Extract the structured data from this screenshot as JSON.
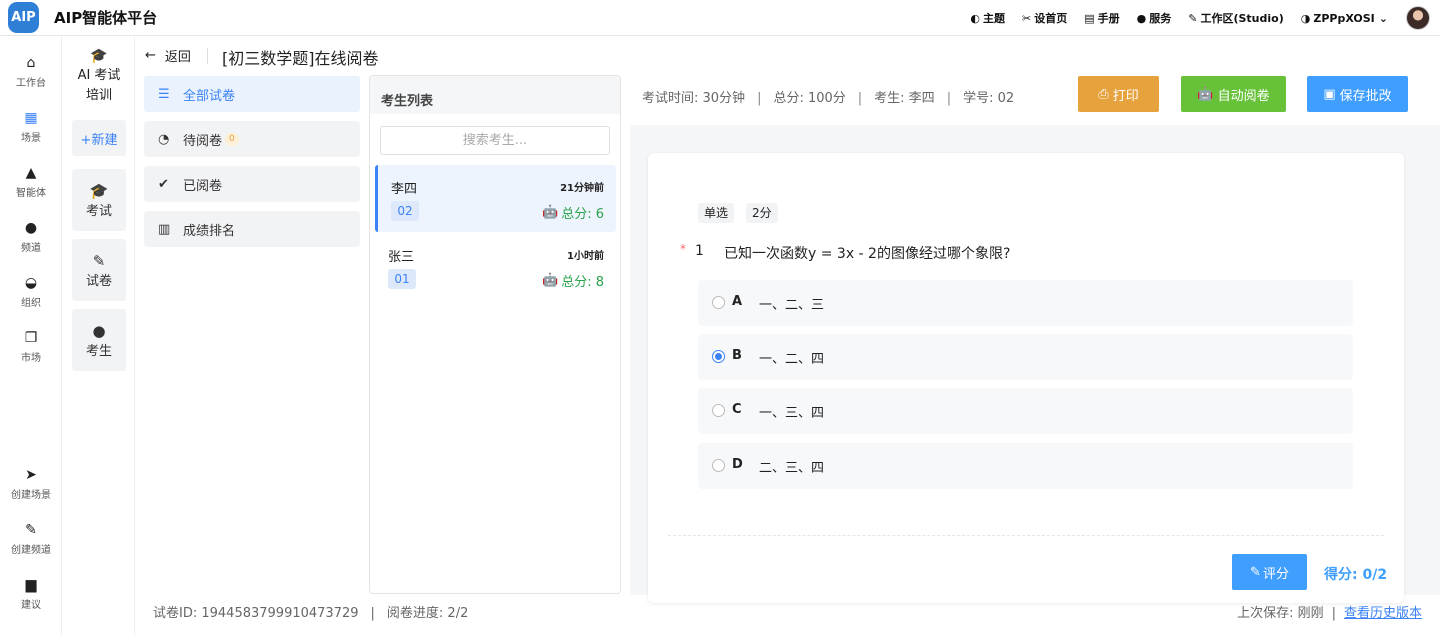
{
  "app": {
    "logo_text": "AIP",
    "title": "AIP智能体平台"
  },
  "topnav": {
    "items": [
      {
        "icon": "moon-icon",
        "glyph": "◐",
        "label": "主题"
      },
      {
        "icon": "tools-icon",
        "glyph": "✂",
        "label": "设首页"
      },
      {
        "icon": "book-icon",
        "glyph": "▤",
        "label": "手册"
      },
      {
        "icon": "users-icon",
        "glyph": "👥",
        "label": "服务"
      },
      {
        "icon": "pen-icon",
        "glyph": "✎",
        "label": "工作区(Studio)"
      },
      {
        "icon": "shield-icon",
        "glyph": "◑",
        "label": "ZPPpXOSI"
      }
    ]
  },
  "rail": {
    "items": [
      {
        "label": "工作台"
      },
      {
        "label": "场景"
      },
      {
        "label": "智能体"
      },
      {
        "label": "频道"
      },
      {
        "label": "组织"
      },
      {
        "label": "市场"
      },
      {
        "label": "创建场景"
      },
      {
        "label": "创建频道"
      },
      {
        "label": "建议"
      }
    ]
  },
  "section": {
    "title_line1": "AI 考试",
    "title_line2": "培训",
    "new_label": "+新建",
    "items": [
      {
        "label": "考试"
      },
      {
        "label": "试卷"
      },
      {
        "label": "考生"
      }
    ]
  },
  "header": {
    "back_label": "返回",
    "title": "[初三数学题]在线阅卷"
  },
  "filters": [
    {
      "label": "全部试卷"
    },
    {
      "label": "待阅卷",
      "badge": "0"
    },
    {
      "label": "已阅卷"
    },
    {
      "label": "成绩排名"
    }
  ],
  "students": {
    "header": "考生列表",
    "search_placeholder": "搜索考生...",
    "list": [
      {
        "name": "李四",
        "time": "21分钟前",
        "id": "02",
        "score": "总分: 6"
      },
      {
        "name": "张三",
        "time": "1小时前",
        "id": "01",
        "score": "总分: 8"
      }
    ]
  },
  "exam_info": {
    "time": "考试时间: 30分钟",
    "total": "总分: 100分",
    "student": "考生: 李四",
    "student_no": "学号: 02"
  },
  "actions": {
    "print": "打印",
    "auto_grade": "自动阅卷",
    "save": "保存批改"
  },
  "question": {
    "type_tag": "单选",
    "points_tag": "2分",
    "required_mark": "*",
    "number": "1",
    "text": "已知一次函数y = 3x - 2的图像经过哪个象限?",
    "selected": "B",
    "options": [
      {
        "letter": "A",
        "text": "一、二、三"
      },
      {
        "letter": "B",
        "text": "一、二、四"
      },
      {
        "letter": "C",
        "text": "一、三、四"
      },
      {
        "letter": "D",
        "text": "二、三、四"
      }
    ],
    "grade_button": "评分",
    "score": "得分: 0/2"
  },
  "footer": {
    "paper_id": "试卷ID: 1944583799910473729",
    "progress": "阅卷进度: 2/2",
    "last_saved": "上次保存: 刚刚",
    "history_link": "查看历史版本"
  },
  "colors": {
    "primary": "#409eff",
    "warning": "#e6a23c",
    "success": "#67c23a",
    "score_green": "#2ba24c"
  }
}
